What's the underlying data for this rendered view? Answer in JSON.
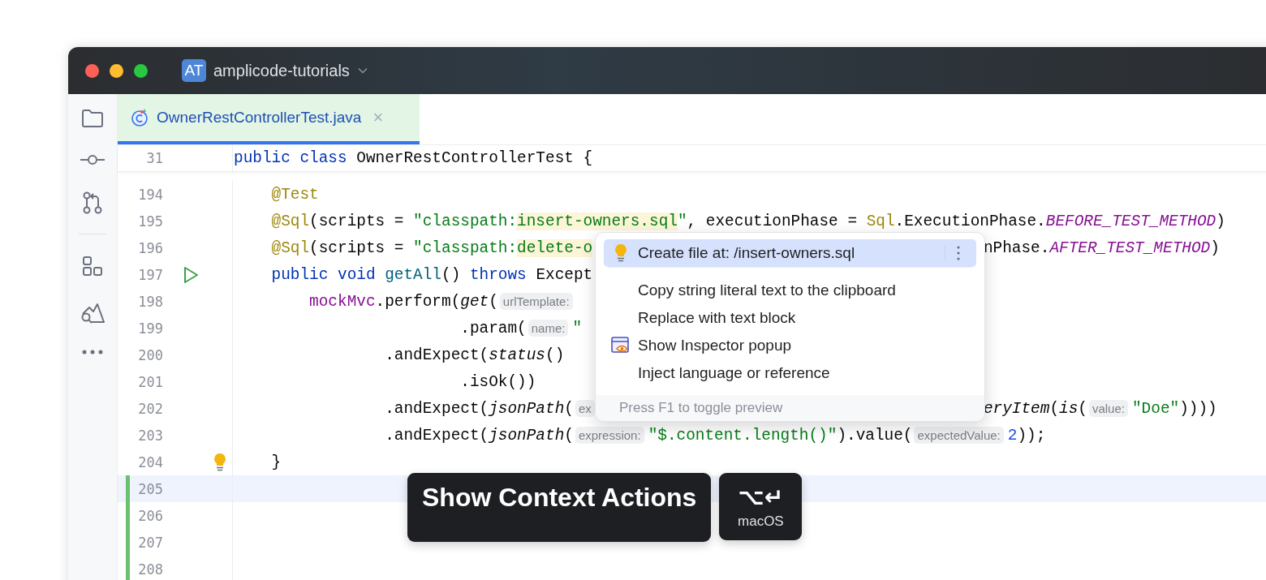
{
  "window": {
    "project_badge": "AT",
    "project": "amplicode-tutorials"
  },
  "toolbar": [
    {
      "kind": "folder"
    },
    {
      "kind": "commit"
    },
    {
      "kind": "branches"
    },
    {
      "kind": "divider"
    },
    {
      "kind": "structure"
    },
    {
      "kind": "mountain"
    },
    {
      "kind": "more"
    }
  ],
  "tabs": [
    {
      "label": "OwnerRestControllerTest.java",
      "selected": true,
      "close": "×"
    }
  ],
  "sticky_line": {
    "number": "31",
    "tokens": [
      {
        "kind": "kw",
        "text": "public class "
      },
      {
        "kind": "plain",
        "text": "OwnerRestControllerTest {"
      }
    ]
  },
  "lines": [
    {
      "number": "194",
      "kind": "plain",
      "current": false,
      "changed": false,
      "left": [
        {
          "kind": "ann",
          "text": "    @Test"
        }
      ]
    },
    {
      "number": "195",
      "kind": "plain",
      "current": false,
      "changed": false,
      "left": [
        {
          "kind": "ann",
          "text": "    @Sql"
        },
        {
          "kind": "plain",
          "text": "(scripts = "
        },
        {
          "kind": "str",
          "text": "\"classpath:"
        },
        {
          "kind": "strhl",
          "text": "insert-owners.sql"
        },
        {
          "kind": "str",
          "text": "\""
        },
        {
          "kind": "plain",
          "text": ", executionPhase = "
        },
        {
          "kind": "ann",
          "text": "Sql"
        },
        {
          "kind": "plain",
          "text": ".ExecutionPhase."
        },
        {
          "kind": "const",
          "text": "BEFORE_TEST_METHOD"
        },
        {
          "kind": "plain",
          "text": ")"
        }
      ]
    },
    {
      "number": "196",
      "kind": "plain",
      "current": false,
      "changed": false,
      "left": [
        {
          "kind": "ann",
          "text": "    @Sql"
        },
        {
          "kind": "plain",
          "text": "(scripts = "
        },
        {
          "kind": "str",
          "text": "\"classpath:"
        },
        {
          "kind": "strhl",
          "text": "delete-o"
        }
      ],
      "right": [
        {
          "kind": "plain",
          "text": "nPhase."
        },
        {
          "kind": "const",
          "text": "AFTER_TEST_METHOD"
        },
        {
          "kind": "plain",
          "text": ")"
        }
      ]
    },
    {
      "number": "197",
      "kind": "run",
      "current": false,
      "changed": false,
      "left": [
        {
          "kind": "kw",
          "text": "    public void "
        },
        {
          "kind": "meth",
          "text": "getAll"
        },
        {
          "kind": "plain",
          "text": "() "
        },
        {
          "kind": "kw",
          "text": "throws "
        },
        {
          "kind": "plain",
          "text": "Except"
        }
      ]
    },
    {
      "number": "198",
      "kind": "plain",
      "current": false,
      "changed": false,
      "left": [
        {
          "kind": "field",
          "text": "        mockMvc"
        },
        {
          "kind": "plain",
          "text": ".perform("
        },
        {
          "kind": "ital",
          "text": "get"
        },
        {
          "kind": "plain",
          "text": "("
        },
        {
          "kind": "hint",
          "text": "urlTemplate:"
        }
      ]
    },
    {
      "number": "199",
      "kind": "plain",
      "current": false,
      "changed": false,
      "left": [
        {
          "kind": "plain",
          "text": "                        .param("
        },
        {
          "kind": "hint",
          "text": "name:"
        },
        {
          "kind": "str",
          "text": "\""
        }
      ]
    },
    {
      "number": "200",
      "kind": "plain",
      "current": false,
      "changed": false,
      "left": [
        {
          "kind": "plain",
          "text": "                .andExpect("
        },
        {
          "kind": "ital",
          "text": "status"
        },
        {
          "kind": "plain",
          "text": "()"
        }
      ]
    },
    {
      "number": "201",
      "kind": "plain",
      "current": false,
      "changed": false,
      "left": [
        {
          "kind": "plain",
          "text": "                        .isOk())"
        }
      ]
    },
    {
      "number": "202",
      "kind": "plain",
      "current": false,
      "changed": false,
      "left": [
        {
          "kind": "plain",
          "text": "                .andExpect("
        },
        {
          "kind": "ital",
          "text": "jsonPath"
        },
        {
          "kind": "plain",
          "text": "("
        },
        {
          "kind": "hint",
          "text": "ex"
        }
      ],
      "right": [
        {
          "kind": "ital",
          "text": "eryItem"
        },
        {
          "kind": "plain",
          "text": "("
        },
        {
          "kind": "ital",
          "text": "is"
        },
        {
          "kind": "plain",
          "text": "("
        },
        {
          "kind": "hint",
          "text": "value:"
        },
        {
          "kind": "str",
          "text": "\"Doe\""
        },
        {
          "kind": "plain",
          "text": "))))"
        }
      ]
    },
    {
      "number": "203",
      "kind": "plain",
      "current": false,
      "changed": false,
      "left": [
        {
          "kind": "plain",
          "text": "                .andExpect("
        },
        {
          "kind": "ital",
          "text": "jsonPath"
        },
        {
          "kind": "plain",
          "text": "("
        },
        {
          "kind": "hint",
          "text": "expression:"
        },
        {
          "kind": "str",
          "text": "\"$.content.length()\""
        },
        {
          "kind": "plain",
          "text": ").value("
        },
        {
          "kind": "hint",
          "text": "expectedValue:"
        },
        {
          "kind": "num",
          "text": "2"
        },
        {
          "kind": "plain",
          "text": "));"
        }
      ]
    },
    {
      "number": "204",
      "kind": "bulb",
      "current": false,
      "changed": false,
      "left": [
        {
          "kind": "plain",
          "text": "    }"
        }
      ]
    },
    {
      "number": "205",
      "kind": "plain",
      "current": true,
      "changed": true
    },
    {
      "number": "206",
      "kind": "plain",
      "current": false,
      "changed": true
    },
    {
      "number": "207",
      "kind": "plain",
      "current": false,
      "changed": true
    },
    {
      "number": "208",
      "kind": "plain",
      "current": false,
      "changed": true
    }
  ],
  "popup": {
    "items": [
      {
        "label": "Create file at: /insert-owners.sql",
        "kind": "bulb",
        "selected": true
      },
      {
        "label": "Copy string literal text to the clipboard",
        "kind": "plain",
        "selected": false
      },
      {
        "label": "Replace with text block",
        "kind": "plain",
        "selected": false
      },
      {
        "label": "Show Inspector popup",
        "kind": "inspector",
        "selected": false
      },
      {
        "label": "Inject language or reference",
        "kind": "plain",
        "selected": false
      }
    ],
    "footer": "Press F1 to toggle preview"
  },
  "tooltip": {
    "action": "Show Context Actions",
    "shortcut": "⌥↵",
    "platform": "macOS"
  }
}
